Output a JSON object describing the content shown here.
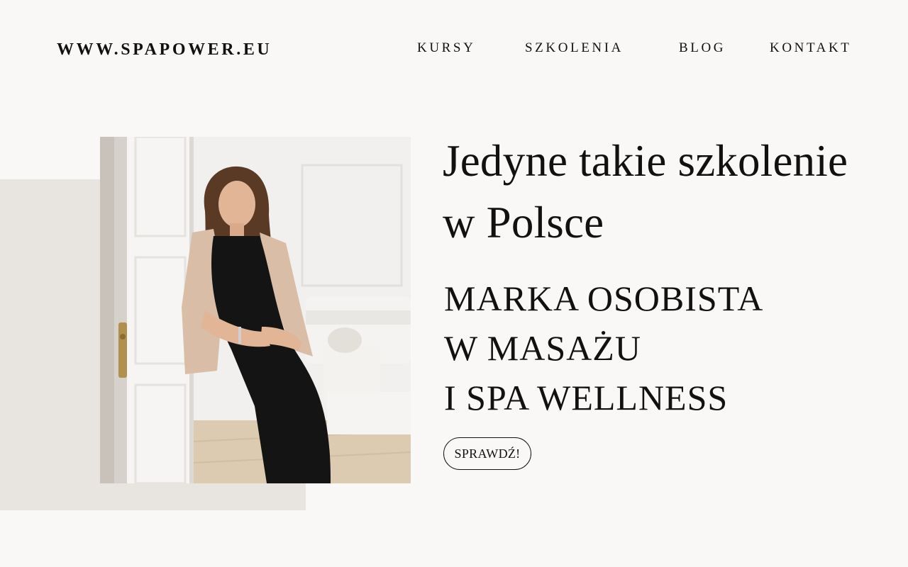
{
  "header": {
    "logo": "WWW.SPAPOWER.EU",
    "nav": {
      "kursy": "KURSY",
      "szkolenia": "SZKOLENIA",
      "blog": "BLOG",
      "kontakt": "KONTAKT"
    }
  },
  "hero": {
    "headline_line1": "Jedyne takie szkolenie",
    "headline_line2": "w Polsce",
    "subhead_line1": "MARKA OSOBISTA",
    "subhead_line2": "W MASAŻU",
    "subhead_line3": "I SPA WELLNESS",
    "cta_label": "SPRAWDŹ!"
  },
  "colors": {
    "page_background": "#f9f8f6",
    "accent_block": "#e8e4e0",
    "text": "#111111"
  }
}
